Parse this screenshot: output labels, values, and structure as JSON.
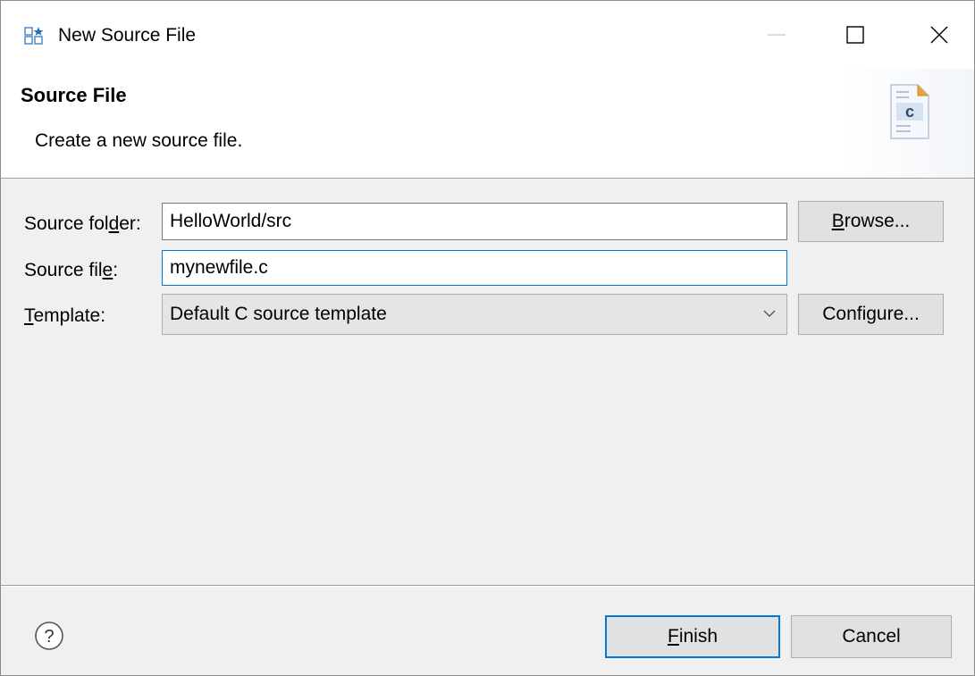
{
  "window": {
    "title": "New Source File",
    "icons": {
      "app": "new-source-file-icon",
      "minimize": "minimize-icon",
      "maximize": "maximize-icon",
      "close": "close-icon"
    }
  },
  "banner": {
    "title": "Source File",
    "description": "Create a new source file.",
    "icon": "c-source-file-icon"
  },
  "form": {
    "source_folder": {
      "label_pre": "Source fol",
      "label_mnemonic": "d",
      "label_post": "er:",
      "value": "HelloWorld/src"
    },
    "source_file": {
      "label_pre": "Source fil",
      "label_mnemonic": "e",
      "label_post": ":",
      "value": "mynewfile.c"
    },
    "template": {
      "label_mnemonic": "T",
      "label_post": "emplate:",
      "selected": "Default C source template"
    },
    "browse_button": {
      "mnemonic": "B",
      "rest": "rowse..."
    },
    "configure_button": {
      "label": "Configure..."
    }
  },
  "footer": {
    "help_icon": "help-icon",
    "finish_button": {
      "mnemonic": "F",
      "rest": "inish"
    },
    "cancel_button": {
      "label": "Cancel"
    }
  },
  "colors": {
    "accent": "#0078d7",
    "dialog_bg": "#f0f0f0"
  }
}
